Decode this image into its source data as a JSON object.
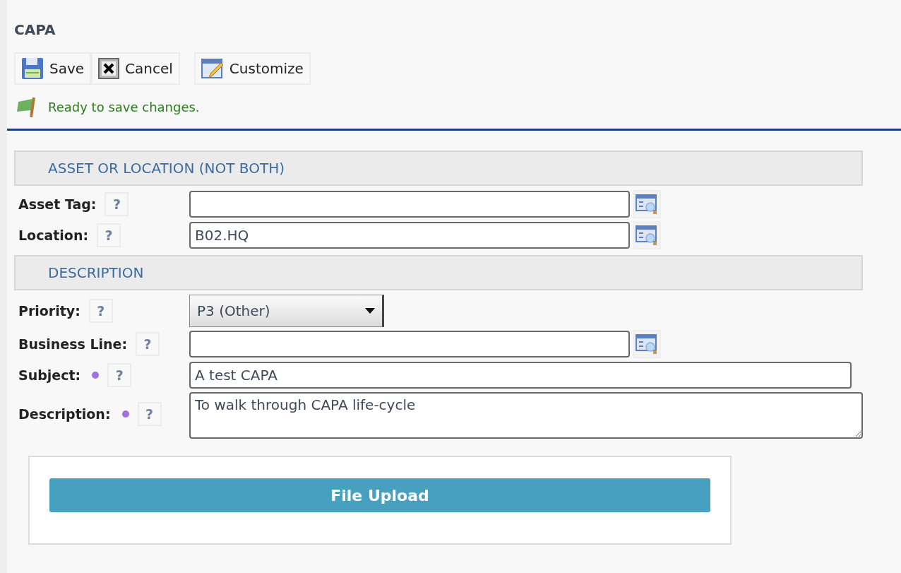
{
  "title": "CAPA",
  "toolbar": [
    {
      "kind": "save",
      "label": "Save"
    },
    {
      "kind": "cancel",
      "label": "Cancel"
    },
    {
      "kind": "customize",
      "label": "Customize"
    }
  ],
  "status": "Ready to save changes.",
  "sections": [
    {
      "heading": "ASSET OR LOCATION (NOT BOTH)",
      "fields": [
        {
          "label": "Asset Tag:",
          "help": "?",
          "kind": "lookup",
          "required": false
        },
        {
          "label": "Location:",
          "help": "?",
          "kind": "lookup",
          "value": "B02.HQ",
          "required": false
        }
      ]
    },
    {
      "heading": "DESCRIPTION",
      "fields": [
        {
          "label": "Priority:",
          "help": "?",
          "kind": "select",
          "value": "P3 (Other)",
          "required": false
        },
        {
          "label": "Business Line:",
          "help": "?",
          "kind": "lookup",
          "required": false
        },
        {
          "label": "Subject:",
          "help": "?",
          "kind": "text",
          "value": "A test CAPA",
          "required": true
        },
        {
          "label": "Description:",
          "help": "?",
          "kind": "textarea",
          "value": "To walk through CAPA life-cycle",
          "required": true
        }
      ]
    }
  ],
  "upload": {
    "label": "File Upload"
  }
}
